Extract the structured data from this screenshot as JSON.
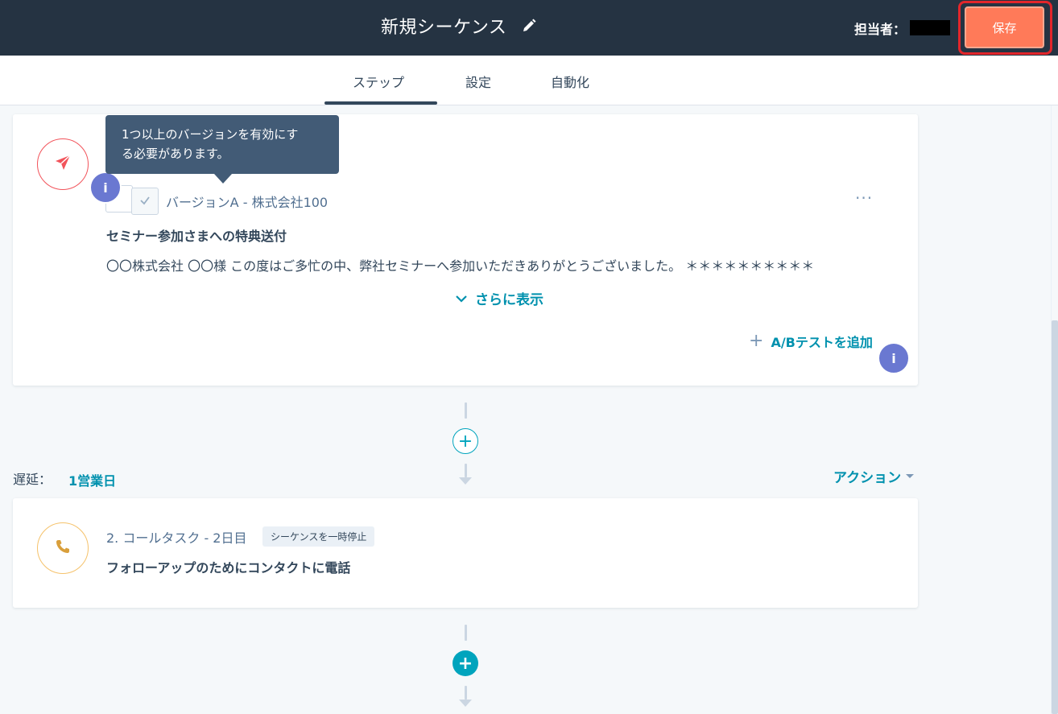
{
  "header": {
    "title": "新規シーケンス",
    "owner_label": "担当者：",
    "save_label": "保存"
  },
  "tabs": [
    {
      "label": "ステップ",
      "active": true
    },
    {
      "label": "設定",
      "active": false
    },
    {
      "label": "自動化",
      "active": false
    }
  ],
  "step1": {
    "tooltip_line1": "1つ以上のバージョンを有効にす",
    "tooltip_line2": "る必要があります。",
    "info_label": "i",
    "version_label": "バージョンA - 株式会社100",
    "more_label": "···",
    "subject": "セミナー参加さまへの特典送付",
    "body": "〇〇株式会社 〇〇様 この度はご多忙の中、弊社セミナーへ参加いただきありがとうございました。 ＊＊＊＊＊＊＊＊＊＊",
    "show_more": "さらに表示",
    "ab_test": "A/Bテストを追加"
  },
  "delay": {
    "label": "遅延：",
    "value": "1営業日",
    "actions": "アクション"
  },
  "step2": {
    "label": "2. コールタスク - 2日目",
    "tag": "シーケンスを一時停止",
    "title": "フォローアップのためにコンタクトに電話"
  },
  "colors": {
    "header_bg": "#253342",
    "save_button": "#ff7a59",
    "accent_teal": "#0091ae",
    "info_purple": "#6a78d1",
    "email_ring": "#f2545b",
    "call_ring": "#f5c26b"
  }
}
